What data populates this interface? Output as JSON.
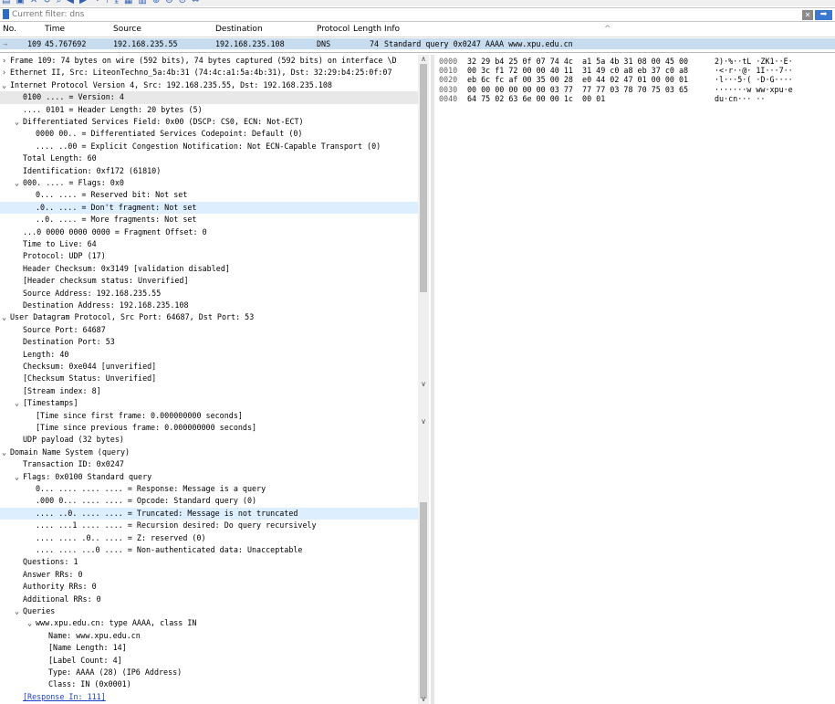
{
  "toolbar": {
    "icons": [
      "folder-icon",
      "save-icon",
      "close-icon",
      "reload-icon",
      "search-icon",
      "back-icon",
      "forward-icon",
      "jump-icon",
      "top-icon",
      "bottom-icon",
      "colorize-icon",
      "autoscroll-icon",
      "zoom-in-icon",
      "zoom-out-icon",
      "zoom-reset-icon",
      "resize-columns-icon"
    ]
  },
  "filter": {
    "placeholder": "Current filter: dns",
    "clear": "✕",
    "apply": "➡"
  },
  "packet_list": {
    "columns": [
      "No.",
      "Time",
      "Source",
      "Destination",
      "Protocol",
      "Length",
      "Info"
    ],
    "rows": [
      {
        "arrow": "→",
        "no": "109",
        "time": "45.767692",
        "source": "192.168.235.55",
        "destination": "192.168.235.108",
        "protocol": "DNS",
        "length": "74",
        "info": "Standard query 0x0247 AAAA www.xpu.edu.cn"
      }
    ]
  },
  "details": [
    {
      "t": ">",
      "indent": 0,
      "text": "Frame 109: 74 bytes on wire (592 bits), 74 bytes captured (592 bits) on interface \\D"
    },
    {
      "t": ">",
      "indent": 0,
      "text": "Ethernet II, Src: LiteonTechno_5a:4b:31 (74:4c:a1:5a:4b:31), Dst: 32:29:b4:25:0f:07"
    },
    {
      "t": "v",
      "indent": 0,
      "text": "Internet Protocol Version 4, Src: 192.168.235.55, Dst: 192.168.235.108"
    },
    {
      "t": "",
      "indent": 1,
      "text": "0100 .... = Version: 4",
      "hl": "gray"
    },
    {
      "t": "",
      "indent": 1,
      "text": ".... 0101 = Header Length: 20 bytes (5)"
    },
    {
      "t": "v",
      "indent": 1,
      "text": "Differentiated Services Field: 0x00 (DSCP: CS0, ECN: Not-ECT)"
    },
    {
      "t": "",
      "indent": 2,
      "text": "0000 00.. = Differentiated Services Codepoint: Default (0)"
    },
    {
      "t": "",
      "indent": 2,
      "text": ".... ..00 = Explicit Congestion Notification: Not ECN-Capable Transport (0)"
    },
    {
      "t": "",
      "indent": 1,
      "text": "Total Length: 60"
    },
    {
      "t": "",
      "indent": 1,
      "text": "Identification: 0xf172 (61810)"
    },
    {
      "t": "v",
      "indent": 1,
      "text": "000. .... = Flags: 0x0"
    },
    {
      "t": "",
      "indent": 2,
      "text": "0... .... = Reserved bit: Not set"
    },
    {
      "t": "",
      "indent": 2,
      "text": ".0.. .... = Don't fragment: Not set",
      "hl": "blue"
    },
    {
      "t": "",
      "indent": 2,
      "text": "..0. .... = More fragments: Not set"
    },
    {
      "t": "",
      "indent": 1,
      "text": "...0 0000 0000 0000 = Fragment Offset: 0"
    },
    {
      "t": "",
      "indent": 1,
      "text": "Time to Live: 64"
    },
    {
      "t": "",
      "indent": 1,
      "text": "Protocol: UDP (17)"
    },
    {
      "t": "",
      "indent": 1,
      "text": "Header Checksum: 0x3149 [validation disabled]"
    },
    {
      "t": "",
      "indent": 1,
      "text": "[Header checksum status: Unverified]"
    },
    {
      "t": "",
      "indent": 1,
      "text": "Source Address: 192.168.235.55"
    },
    {
      "t": "",
      "indent": 1,
      "text": "Destination Address: 192.168.235.108"
    },
    {
      "t": "v",
      "indent": 0,
      "text": "User Datagram Protocol, Src Port: 64687, Dst Port: 53"
    },
    {
      "t": "",
      "indent": 1,
      "text": "Source Port: 64687"
    },
    {
      "t": "",
      "indent": 1,
      "text": "Destination Port: 53"
    },
    {
      "t": "",
      "indent": 1,
      "text": "Length: 40"
    },
    {
      "t": "",
      "indent": 1,
      "text": "Checksum: 0xe044 [unverified]"
    },
    {
      "t": "",
      "indent": 1,
      "text": "[Checksum Status: Unverified]"
    },
    {
      "t": "",
      "indent": 1,
      "text": "[Stream index: 8]"
    },
    {
      "t": "v",
      "indent": 1,
      "text": "[Timestamps]"
    },
    {
      "t": "",
      "indent": 2,
      "text": "[Time since first frame: 0.000000000 seconds]"
    },
    {
      "t": "",
      "indent": 2,
      "text": "[Time since previous frame: 0.000000000 seconds]"
    },
    {
      "t": "",
      "indent": 1,
      "text": "UDP payload (32 bytes)"
    },
    {
      "t": "v",
      "indent": 0,
      "text": "Domain Name System (query)"
    },
    {
      "t": "",
      "indent": 1,
      "text": "Transaction ID: 0x0247"
    },
    {
      "t": "v",
      "indent": 1,
      "text": "Flags: 0x0100 Standard query"
    },
    {
      "t": "",
      "indent": 2,
      "text": "0... .... .... .... = Response: Message is a query"
    },
    {
      "t": "",
      "indent": 2,
      "text": ".000 0... .... .... = Opcode: Standard query (0)"
    },
    {
      "t": "",
      "indent": 2,
      "text": ".... ..0. .... .... = Truncated: Message is not truncated",
      "hl": "blue"
    },
    {
      "t": "",
      "indent": 2,
      "text": ".... ...1 .... .... = Recursion desired: Do query recursively"
    },
    {
      "t": "",
      "indent": 2,
      "text": ".... .... .0.. .... = Z: reserved (0)"
    },
    {
      "t": "",
      "indent": 2,
      "text": ".... .... ...0 .... = Non-authenticated data: Unacceptable"
    },
    {
      "t": "",
      "indent": 1,
      "text": "Questions: 1"
    },
    {
      "t": "",
      "indent": 1,
      "text": "Answer RRs: 0"
    },
    {
      "t": "",
      "indent": 1,
      "text": "Authority RRs: 0"
    },
    {
      "t": "",
      "indent": 1,
      "text": "Additional RRs: 0"
    },
    {
      "t": "v",
      "indent": 1,
      "text": "Queries"
    },
    {
      "t": "v",
      "indent": 2,
      "text": "www.xpu.edu.cn: type AAAA, class IN"
    },
    {
      "t": "",
      "indent": 3,
      "text": "Name: www.xpu.edu.cn"
    },
    {
      "t": "",
      "indent": 3,
      "text": "[Name Length: 14]"
    },
    {
      "t": "",
      "indent": 3,
      "text": "[Label Count: 4]"
    },
    {
      "t": "",
      "indent": 3,
      "text": "Type: AAAA (28) (IP6 Address)"
    },
    {
      "t": "",
      "indent": 3,
      "text": "Class: IN (0x0001)"
    },
    {
      "t": "",
      "indent": 1,
      "text": "[Response In: 111]",
      "link": true
    }
  ],
  "scroll_arrows": {
    "up": "∧",
    "down": "∨"
  },
  "hex_rows": [
    {
      "offset": "0000",
      "hex": "32 29 b4 25 0f 07 74 4c  a1 5a 4b 31 08 00 45 00",
      "ascii": "2)·%··tL ·ZK1··E·"
    },
    {
      "offset": "0010",
      "hex": "00 3c f1 72 00 00 40 11  31 49 c0 a8 eb 37 c0 a8",
      "ascii": "·<·r··@· 1I···7··"
    },
    {
      "offset": "0020",
      "hex": "eb 6c fc af 00 35 00 28  e0 44 02 47 01 00 00 01",
      "ascii": "·l···5·( ·D·G····"
    },
    {
      "offset": "0030",
      "hex": "00 00 00 00 00 00 03 77  77 77 03 78 70 75 03 65",
      "ascii": "·······w ww·xpu·e"
    },
    {
      "offset": "0040",
      "hex": "64 75 02 63 6e 00 00 1c  00 01",
      "ascii": "du·cn··· ··"
    }
  ]
}
